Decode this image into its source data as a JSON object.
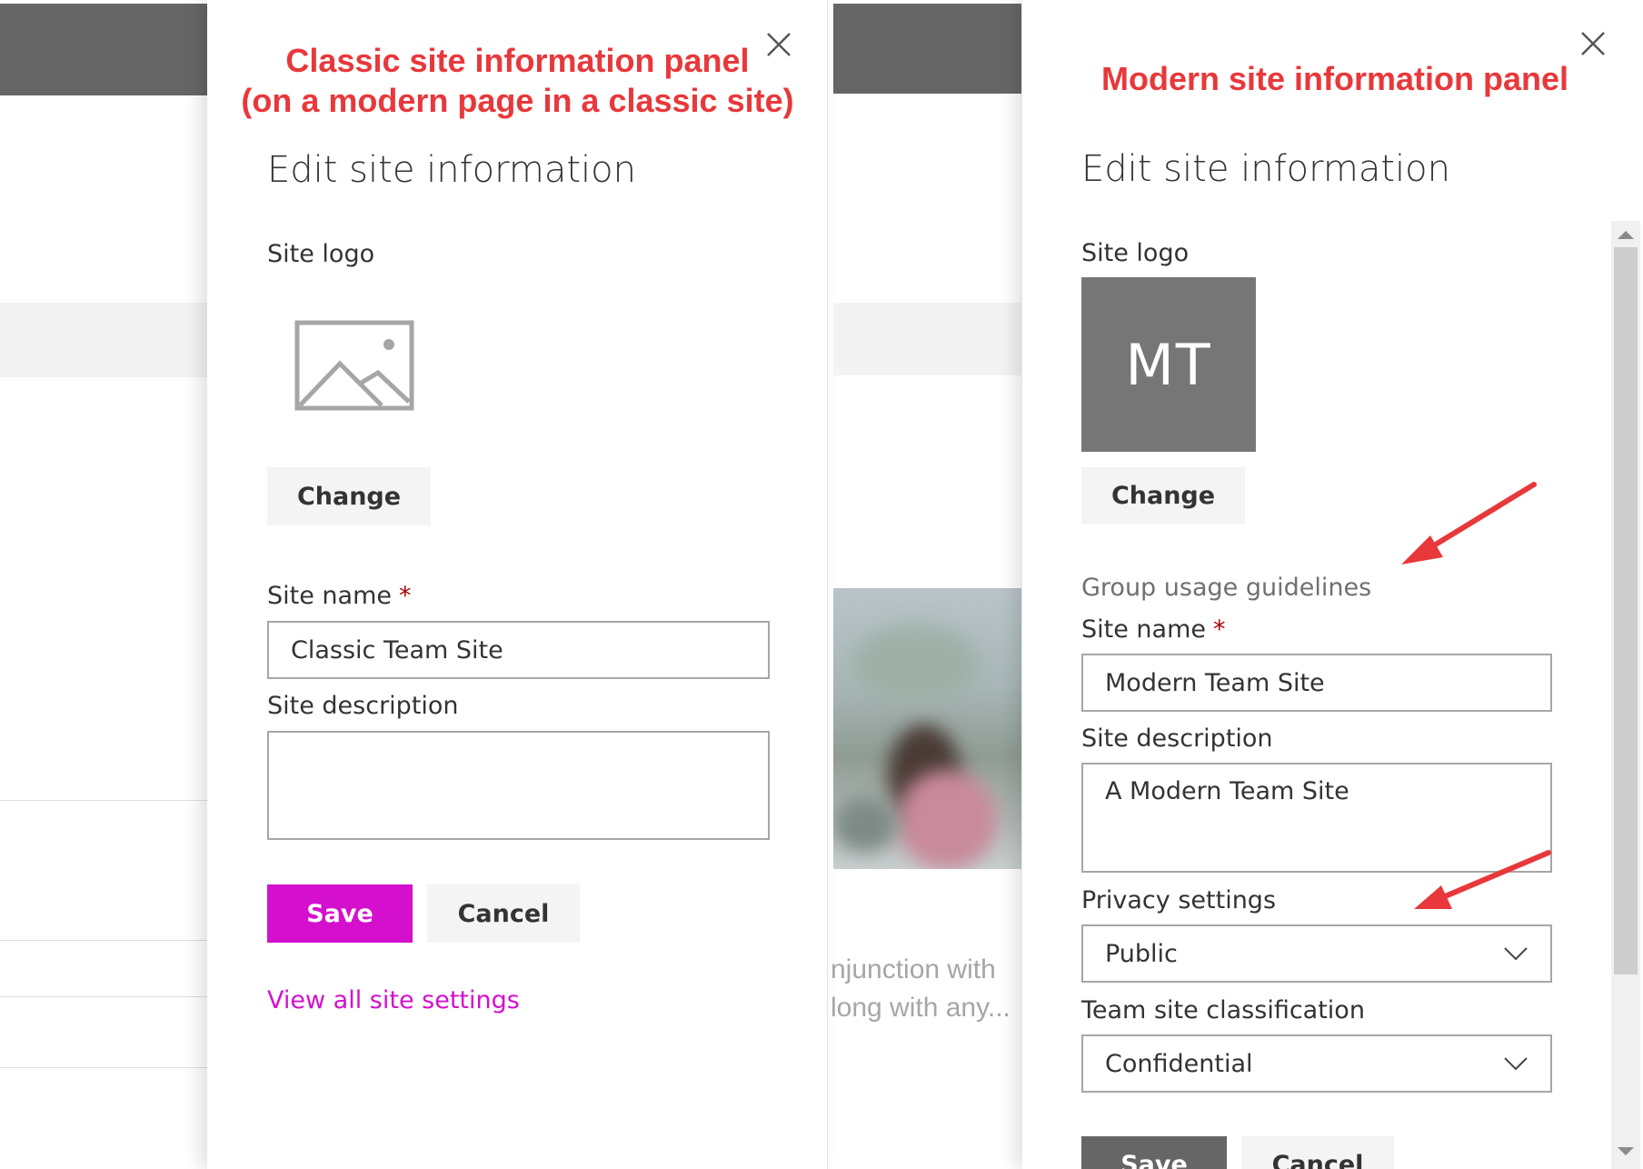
{
  "annotations": {
    "classic_line1": "Classic site information panel",
    "classic_line2": "(on a modern page in a classic site)",
    "modern": "Modern site information panel"
  },
  "background": {
    "middle_text_line1": "njunction with",
    "middle_text_line2": "long with any..."
  },
  "classic_panel": {
    "heading": "Edit site information",
    "site_logo_label": "Site logo",
    "logo_icon": "image-placeholder-icon",
    "change_button": "Change",
    "site_name_label": "Site name",
    "required_mark": "*",
    "site_name_value": "Classic Team Site",
    "site_description_label": "Site description",
    "site_description_value": "",
    "save_button": "Save",
    "cancel_button": "Cancel",
    "view_all_link": "View all site settings"
  },
  "modern_panel": {
    "heading": "Edit site information",
    "site_logo_label": "Site logo",
    "logo_initials": "MT",
    "change_button": "Change",
    "group_guidelines": "Group usage guidelines",
    "site_name_label": "Site name",
    "required_mark": "*",
    "site_name_value": "Modern Team Site",
    "site_description_label": "Site description",
    "site_description_value": "A Modern Team Site",
    "privacy_label": "Privacy settings",
    "privacy_value": "Public",
    "classification_label": "Team site classification",
    "classification_value": "Confidential",
    "save_button": "Save",
    "cancel_button": "Cancel"
  },
  "colors": {
    "annotation_red": "#e8383b",
    "accent_magenta": "#d40fce",
    "logo_tile_gray": "#767676",
    "required_red": "#a80000"
  }
}
